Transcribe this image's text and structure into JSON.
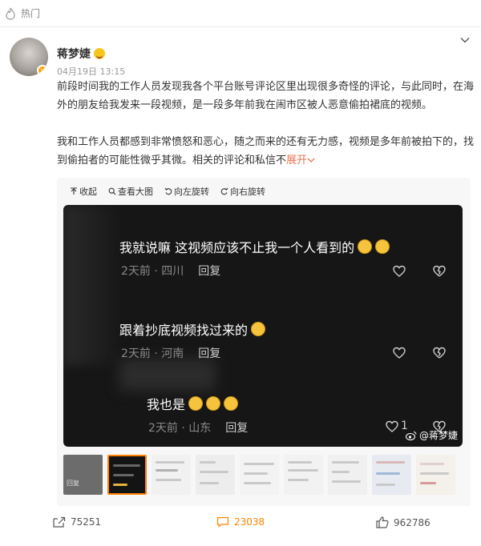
{
  "hot": {
    "label": "热门"
  },
  "author": {
    "name": "蒋梦婕",
    "time": "04月19日 13:15"
  },
  "post": {
    "para1": "前段时间我的工作人员发现我各个平台账号评论区里出现很多奇怪的评论，与此同时，在海外的朋友给我发来一段视频，是一段多年前我在闹市区被人恶意偷拍裙底的视频。",
    "para2": "我和工作人员都感到非常愤怒和恶心，随之而来的还有无力感，视频是多年前被拍下的，找到偷拍者的可能性微乎其微。相关的评论和私信不",
    "expand": "展开"
  },
  "toolbar": {
    "collapse": "收起",
    "view_large": "查看大图",
    "rotate_left": "向左旋转",
    "rotate_right": "向右旋转"
  },
  "image": {
    "comments": [
      {
        "text": "我就说嘛 这视频应该不止我一个人看到的",
        "meta": "2天前 · 四川",
        "reply": "回复"
      },
      {
        "text": "跟着抄底视频找过来的",
        "meta": "2天前 · 河南",
        "reply": "回复"
      },
      {
        "text": "我也是",
        "meta": "2天前 · 山东",
        "reply": "回复",
        "likes": "1"
      }
    ],
    "watermark": "@蒋梦婕"
  },
  "thumbs": {
    "first_label": "回复"
  },
  "actions": {
    "share": "75251",
    "comment": "23038",
    "like": "962786"
  },
  "colors": {
    "accent": "#eb7350",
    "brand": "#ff8200"
  }
}
